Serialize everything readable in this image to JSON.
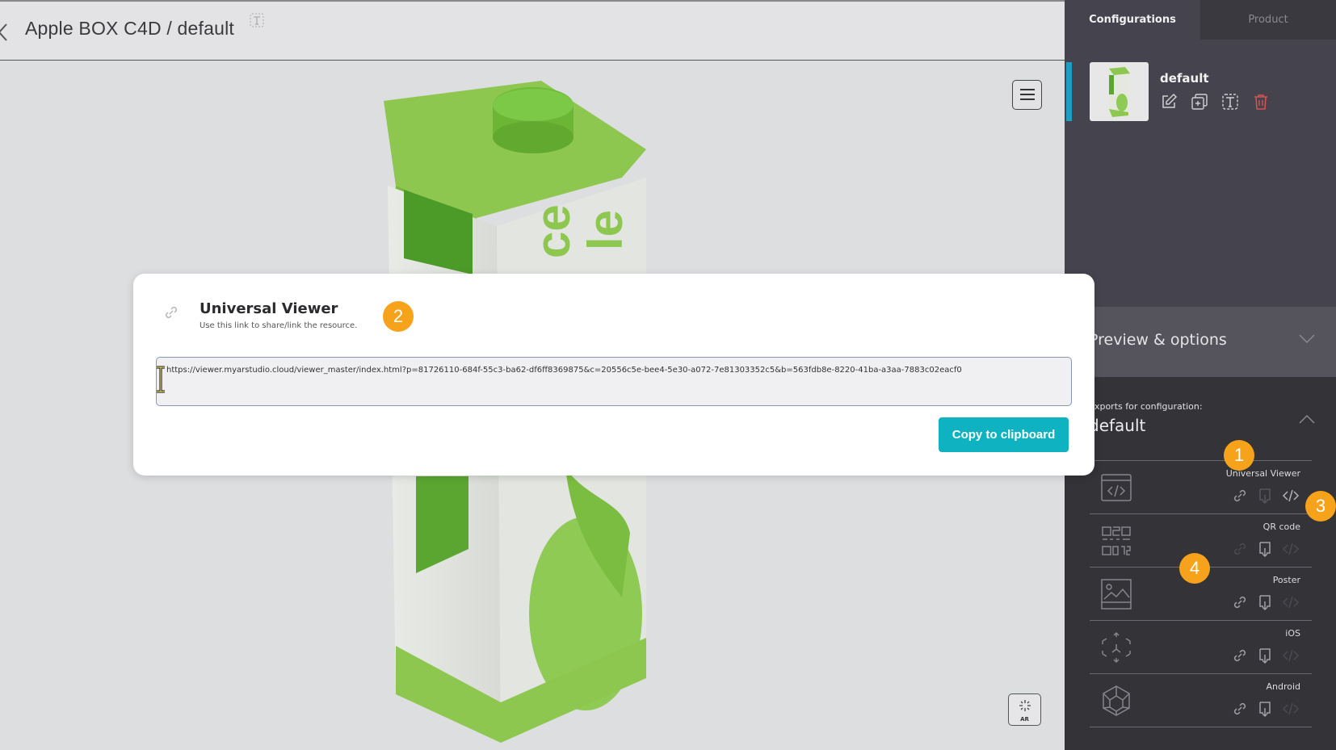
{
  "header": {
    "title": "Apple BOX C4D / default"
  },
  "viewer": {
    "ar_label": "AR"
  },
  "panel": {
    "tabs": [
      {
        "label": "Configurations",
        "active": true
      },
      {
        "label": "Product",
        "active": false
      }
    ],
    "configuration": {
      "name": "default",
      "actions": [
        "edit-icon",
        "duplicate-icon",
        "rename-icon",
        "delete-icon"
      ]
    },
    "preview": {
      "title": "Preview & options"
    },
    "exports": {
      "label": "Exports for configuration:",
      "config_name": "default",
      "items": [
        {
          "name": "Universal Viewer",
          "icon": "code-window-icon",
          "link_enabled": true,
          "download_enabled": false,
          "embed_enabled": true
        },
        {
          "name": "QR code",
          "icon": "qr-code-icon",
          "link_enabled": false,
          "download_enabled": true,
          "embed_enabled": false
        },
        {
          "name": "Poster",
          "icon": "image-icon",
          "link_enabled": true,
          "download_enabled": true,
          "embed_enabled": false
        },
        {
          "name": "iOS",
          "icon": "ar-cube-icon",
          "link_enabled": true,
          "download_enabled": true,
          "embed_enabled": false
        },
        {
          "name": "Android",
          "icon": "3d-box-icon",
          "link_enabled": true,
          "download_enabled": true,
          "embed_enabled": false
        }
      ]
    }
  },
  "modal": {
    "title": "Universal Viewer",
    "subtitle": "Use this link to share/link the resource.",
    "url": "https://viewer.myarstudio.cloud/viewer_master/index.html?p=81726110-684f-55c3-ba62-df6ff8369875&c=20556c5e-bee4-5e30-a072-7e81303352c5&b=563fdb8e-8220-41ba-a3aa-7883c02eacf0",
    "copy_label": "Copy to clipboard"
  },
  "badges": [
    "1",
    "2",
    "3",
    "4"
  ],
  "colors": {
    "accent": "#0fb2c0",
    "badge": "#f7a21b",
    "active_stripe": "#1e9ec4",
    "delete": "#d9534f"
  }
}
